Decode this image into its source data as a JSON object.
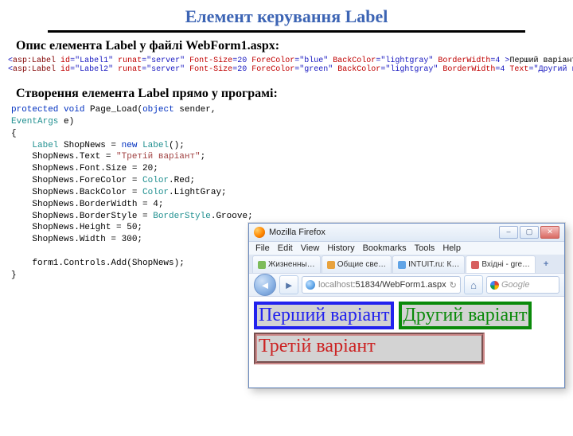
{
  "title": "Елемент керування Label",
  "section1": "Опис елемента Label у файлі WebForm1.aspx:",
  "section2": "Створення елемента Label прямо у програмі:",
  "aspx": {
    "line1": {
      "id": "\"Label1\"",
      "runat": "\"server\"",
      "fontsize": "20",
      "fore": "\"blue\"",
      "back": "\"lightgray\"",
      "bw": "4",
      "inner": "Перший варіант "
    },
    "line2": {
      "id": "\"Label2\"",
      "runat": "\"server\"",
      "fontsize": "20",
      "fore": "\"green\"",
      "back": "\"lightgray\"",
      "bw": "4",
      "text": "\"Другий варіант\""
    }
  },
  "cs": {
    "sig_kw1": "protected",
    "sig_kw2": "void",
    "sig_name": " Page_Load(",
    "sig_kw3": "object",
    "sig_mid": " sender, ",
    "sig_typ": "EventArgs",
    "sig_end": " e)",
    "l_open": "{",
    "l1a": "Label",
    "l1b": " ShopNews = ",
    "l1c": "new",
    "l1d": "Label",
    "l1e": "();",
    "l2a": "    ShopNews.Text = ",
    "l2b": "\"Третій варіант\"",
    "l2c": ";",
    "l3": "    ShopNews.Font.Size = 20;",
    "l4a": "    ShopNews.ForeColor = ",
    "l4b": "Color",
    "l4c": ".Red;",
    "l5a": "    ShopNews.BackColor = ",
    "l5b": "Color",
    "l5c": ".LightGray;",
    "l6": "    ShopNews.BorderWidth = 4;",
    "l7a": "    ShopNews.BorderStyle = ",
    "l7b": "BorderStyle",
    "l7c": ".Groove;",
    "l8": "    ShopNews.Height = 50;",
    "l9": "    ShopNews.Width = 300;",
    "l10": "    form1.Controls.Add(ShopNews);",
    "l_close": "}"
  },
  "browser": {
    "title": "Mozilla Firefox",
    "menu": {
      "file": "File",
      "edit": "Edit",
      "view": "View",
      "history": "History",
      "bookmarks": "Bookmarks",
      "tools": "Tools",
      "help": "Help"
    },
    "tabs": [
      {
        "label": "Жизненны…"
      },
      {
        "label": "Общие све…"
      },
      {
        "label": "INTUIT.ru: К…"
      },
      {
        "label": "Вхідні - gre…"
      }
    ],
    "url_host": "localhost",
    "url_rest": ":51834/WebForm1.aspx",
    "search_ph": "Google",
    "labels": {
      "l1": "Перший варіант",
      "l2": "Другий варіант",
      "l3": "Третій варіант"
    }
  }
}
